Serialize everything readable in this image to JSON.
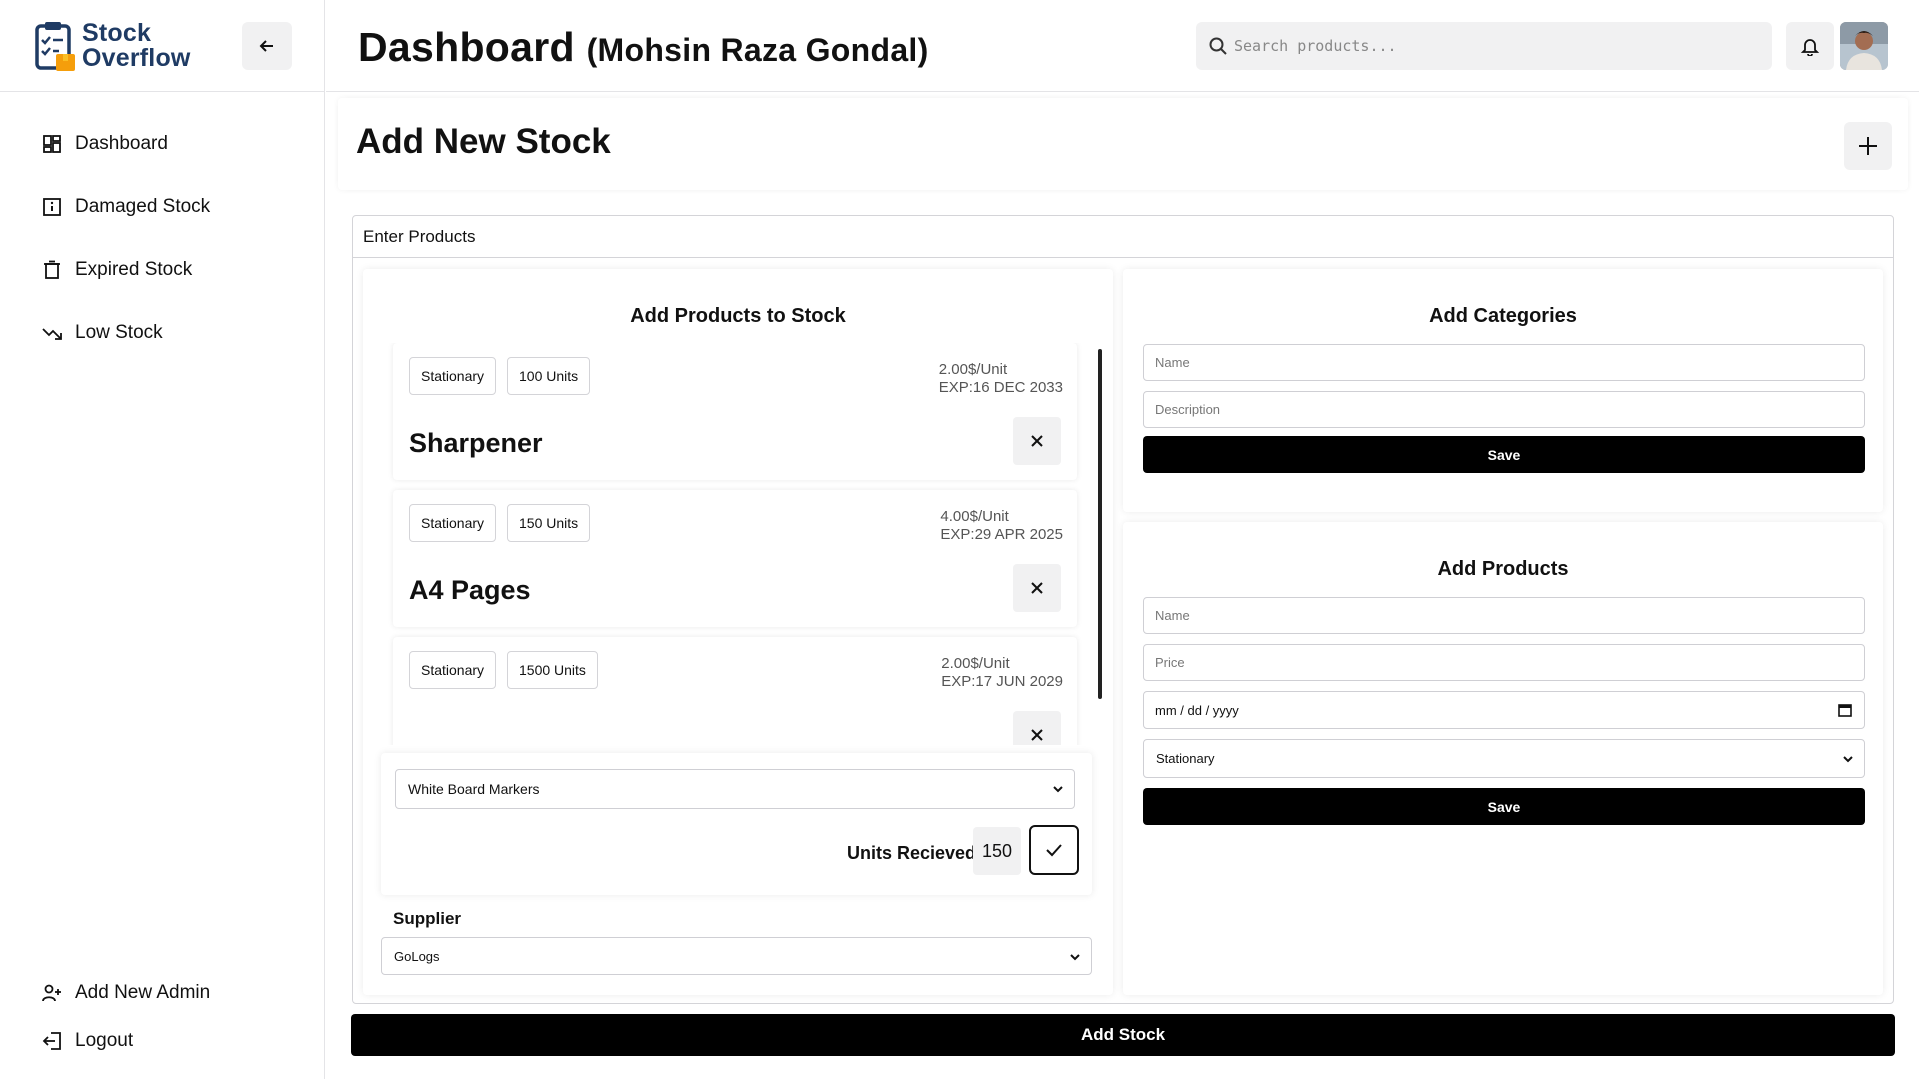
{
  "brand": {
    "line1": "Stock",
    "line2": "Overflow"
  },
  "header": {
    "title": "Dashboard",
    "user": "(Mohsin Raza Gondal)",
    "search_placeholder": "Search products..."
  },
  "sidebar": {
    "items": [
      {
        "label": "Dashboard",
        "icon": "dashboard-grid-icon"
      },
      {
        "label": "Damaged Stock",
        "icon": "info-square-icon"
      },
      {
        "label": "Expired Stock",
        "icon": "trash-icon"
      },
      {
        "label": "Low Stock",
        "icon": "trend-down-icon"
      }
    ],
    "bottom": [
      {
        "label": "Add New Admin",
        "icon": "user-plus-icon"
      },
      {
        "label": "Logout",
        "icon": "logout-icon"
      }
    ]
  },
  "section": {
    "title": "Add New Stock"
  },
  "panel": {
    "title": "Enter Products"
  },
  "left_card": {
    "title": "Add Products to Stock",
    "products": [
      {
        "category": "Stationary",
        "units": "100 Units",
        "price": "2.00$/Unit",
        "exp": "EXP:16 DEC 2033",
        "name": "Sharpener"
      },
      {
        "category": "Stationary",
        "units": "150 Units",
        "price": "4.00$/Unit",
        "exp": "EXP:29 APR 2025",
        "name": "A4 Pages"
      },
      {
        "category": "Stationary",
        "units": "1500 Units",
        "price": "2.00$/Unit",
        "exp": "EXP:17 JUN 2029",
        "name": ""
      }
    ],
    "product_select": "White Board Markers",
    "units_label": "Units Recieved",
    "units_value": "150",
    "supplier_label": "Supplier",
    "supplier_select": "GoLogs"
  },
  "categories_card": {
    "title": "Add Categories",
    "name_placeholder": "Name",
    "description_placeholder": "Description",
    "save_label": "Save"
  },
  "products_card": {
    "title": "Add Products",
    "name_placeholder": "Name",
    "price_placeholder": "Price",
    "date_placeholder": "mm / dd / yyyy",
    "category_select": "Stationary",
    "save_label": "Save"
  },
  "add_stock_label": "Add Stock",
  "colors": {
    "brand_navy": "#1f3b64",
    "brand_orange": "#f59e0b",
    "button_black": "#000000"
  }
}
